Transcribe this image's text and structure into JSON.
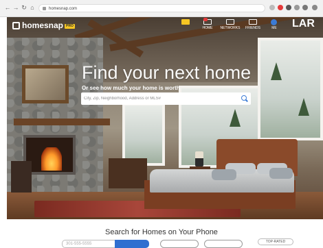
{
  "browser": {
    "url": "homesnap.com",
    "nav_back": "←",
    "nav_forward": "→",
    "nav_reload": "↻",
    "nav_home": "⌂"
  },
  "header": {
    "logo_text": "homesnap",
    "logo_badge": "PRO",
    "nav_items": [
      {
        "label": "",
        "icon": "search-icon"
      },
      {
        "label": "HOME",
        "icon": "home-icon"
      },
      {
        "label": "NETWORKS",
        "icon": "chat-icon"
      },
      {
        "label": "FRIENDS",
        "icon": "people-icon"
      },
      {
        "label": "ME",
        "icon": "user-icon"
      }
    ],
    "brand_mark": "LAR"
  },
  "hero": {
    "title": "Find your next home",
    "subtitle": "Or see how much your home is worth",
    "search_placeholder": "City, Zip, Neighborhood, Address or MLS#"
  },
  "bottom": {
    "title": "Search for Homes on Your Phone",
    "phone_placeholder": "301-555-5555",
    "top_rated": "TOP-RATED"
  },
  "colors": {
    "accent": "#3b7bd6",
    "badge": "#f7c623",
    "notification": "#e4393a"
  }
}
